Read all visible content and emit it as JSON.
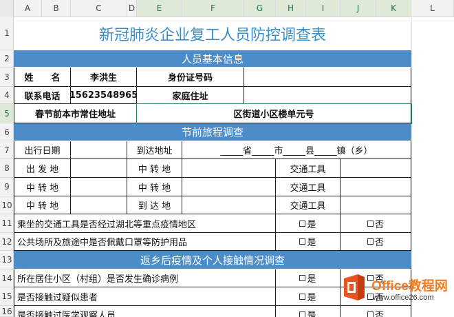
{
  "columns": [
    "A",
    "B",
    "C",
    "D",
    "E",
    "F",
    "G",
    "H",
    "I",
    "J",
    "K",
    "L"
  ],
  "rows": [
    "1",
    "2",
    "3",
    "4",
    "5",
    "6",
    "7",
    "8",
    "9",
    "10",
    "11",
    "12",
    "13",
    "14",
    "15",
    "16"
  ],
  "form": {
    "title": "新冠肺炎企业复工人员防控调查表",
    "section_basic": "人员基本信息",
    "name_label": "姓　　名",
    "name_value": "李洪生",
    "id_label": "身份证号码",
    "phone_label": "联系电话",
    "phone_value": "15623548965",
    "address_label": "家庭住址",
    "home_label": "春节前本市常住地址",
    "home_value": "区街道小区楼单元号",
    "section_travel": "节前旅程调查",
    "depart_date": "出行日期",
    "arrive_addr": "到达地址",
    "addr_template": "_____省_____市_____县_____镇（乡）",
    "depart_place": "出 发 地",
    "transit1": "中 转 地",
    "transport1": "交通工具",
    "transit2": "中 转 地",
    "transit3": "中 转 地",
    "transport2": "交通工具",
    "transit4": "中 转 地",
    "arrive_place": "到 达 地",
    "transport3": "交通工具",
    "q_hubei": "乘坐的交通工具是否经过湖北等重点疫情地区",
    "q_mask": "公共场所及旅途中是否佩戴口罩等防护用品",
    "section_after": "返乡后疫情及个人接触情况调查",
    "q_community": "所在居住小区（村组）是否发生确诊病例",
    "q_contact": "是否接触过疑似患者",
    "q_observed": "是否接触过医学观察人员",
    "yes": "是",
    "no": "否"
  },
  "watermark": {
    "name": "Office教程网",
    "url": "www.office26.com"
  },
  "colors": {
    "band": "#4c8cc9",
    "title": "#3a8fc9",
    "selection": "#217346",
    "watermark": "#f47b20"
  }
}
